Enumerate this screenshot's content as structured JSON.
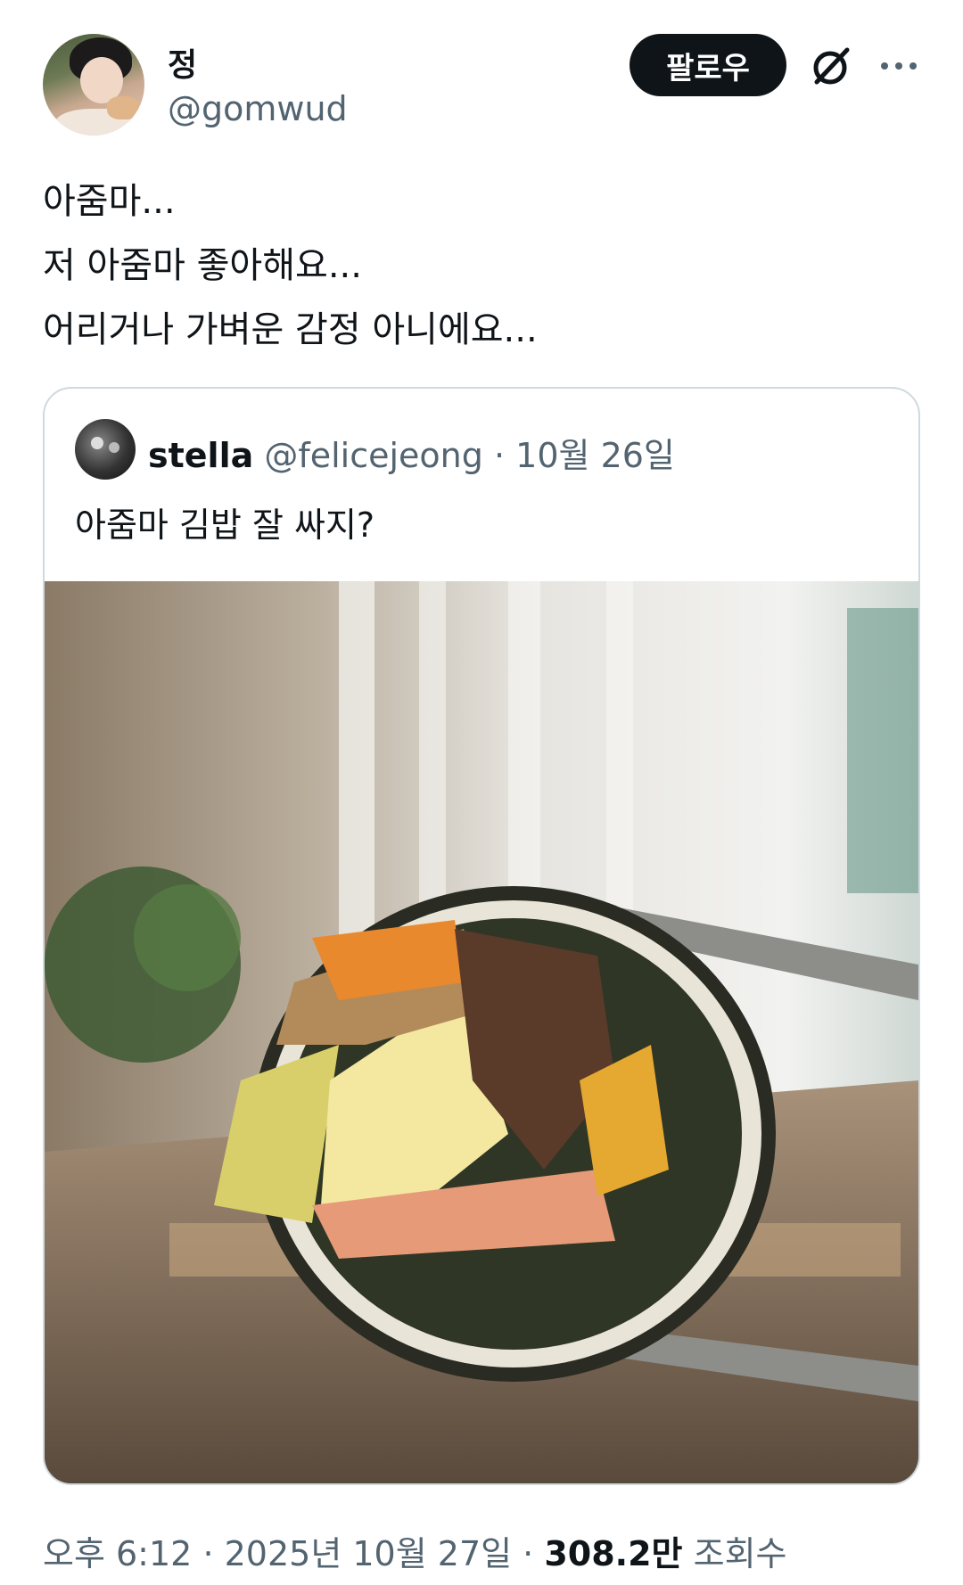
{
  "author": {
    "name": "정",
    "handle": "@gomwud"
  },
  "actions": {
    "follow_label": "팔로우",
    "grok_icon": "grok-icon",
    "more_icon": "more-icon"
  },
  "tweet": {
    "lines": [
      "아줌마...",
      "저 아줌마 좋아해요...",
      "어리거나 가벼운 감정 아니에요..."
    ]
  },
  "quoted": {
    "name": "stella",
    "handle": "@felicejeong",
    "separator": "·",
    "date": "10월 26일",
    "text": "아줌마 김밥 잘 싸지?"
  },
  "meta": {
    "time": "오후 6:12",
    "separator": "·",
    "date": "2025년 10월 27일",
    "views_count": "308.2만",
    "views_label": "조회수"
  },
  "colors": {
    "text_primary": "#0f1419",
    "text_secondary": "#536471",
    "border": "#cfd9de",
    "button_bg": "#0f1419"
  }
}
